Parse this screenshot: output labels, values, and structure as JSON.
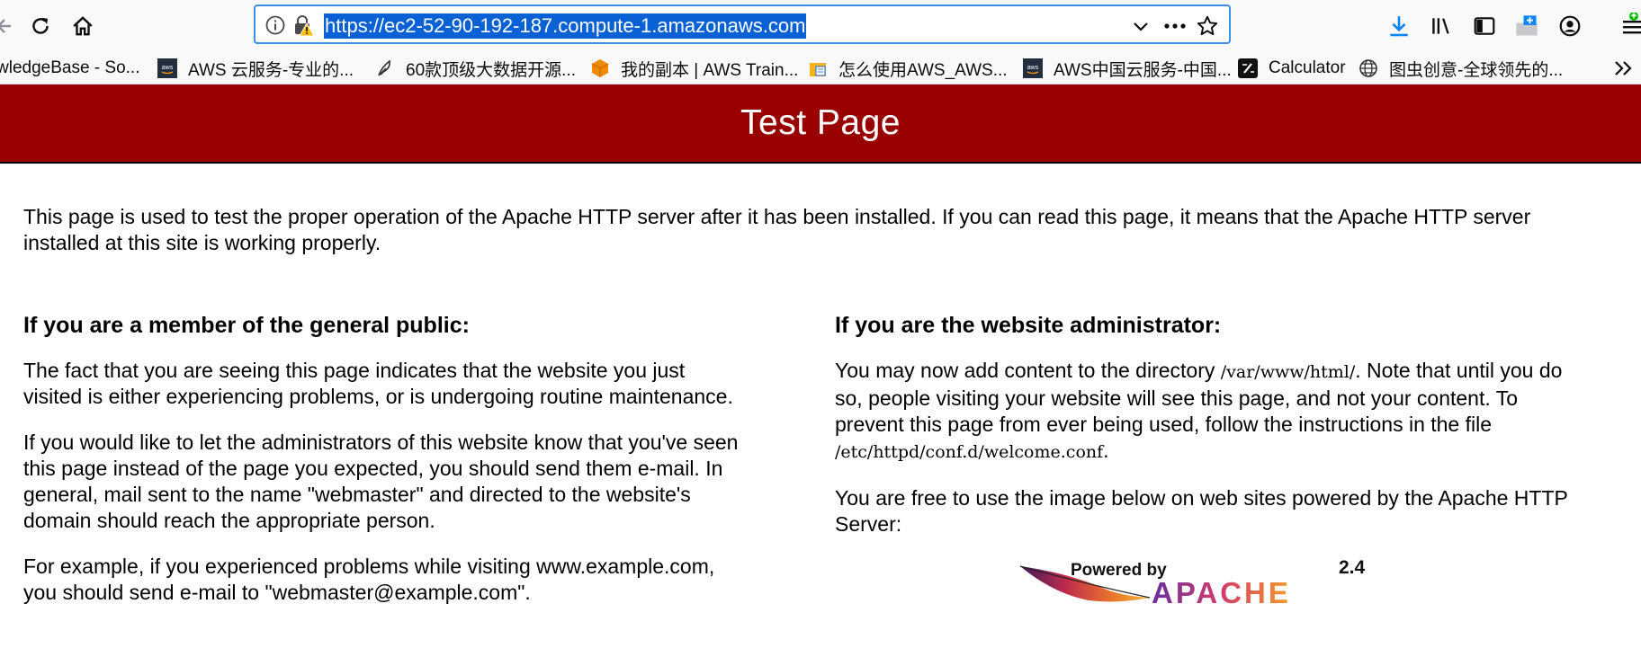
{
  "browser": {
    "url": "https://ec2-52-90-192-187.compute-1.amazonaws.com",
    "icons": [
      "back-icon",
      "reload-icon",
      "home-icon",
      "info-icon",
      "insecure-lock-icon",
      "dropdown-chevron-icon",
      "more-dots-icon",
      "bookmark-star-icon",
      "download-icon",
      "library-icon",
      "sidebar-icon",
      "screenshot-icon",
      "account-icon",
      "menu-icon"
    ],
    "accent_color": "#0a61d6"
  },
  "bookmarks": [
    {
      "label": "wledgeBase - So...",
      "icon": "none"
    },
    {
      "label": "AWS 云服务-专业的...",
      "icon": "aws-icon"
    },
    {
      "label": "60款顶级大数据开源...",
      "icon": "feather-icon"
    },
    {
      "label": "我的副本 | AWS Train...",
      "icon": "cube-icon"
    },
    {
      "label": "怎么使用AWS_AWS...",
      "icon": "box-icon"
    },
    {
      "label": "AWS中国云服务-中国...",
      "icon": "aws-icon"
    },
    {
      "label": "Calculator",
      "icon": "calculator-icon"
    },
    {
      "label": "图虫创意-全球领先的...",
      "icon": "globe-icon"
    }
  ],
  "page": {
    "title": "Test Page",
    "banner_color": "#990000",
    "intro": "This page is used to test the proper operation of the Apache HTTP server after it has been installed. If you can read this page, it means that the Apache HTTP server installed at this site is working properly.",
    "public": {
      "heading": "If you are a member of the general public:",
      "p1": "The fact that you are seeing this page indicates that the website you just visited is either experiencing problems, or is undergoing routine maintenance.",
      "p2": "If you would like to let the administrators of this website know that you've seen this page instead of the page you expected, you should send them e-mail. In general, mail sent to the name \"webmaster\" and directed to the website's domain should reach the appropriate person.",
      "p3": "For example, if you experienced problems while visiting www.example.com, you should send e-mail to \"webmaster@example.com\"."
    },
    "admin": {
      "heading": "If you are the website administrator:",
      "p1_a": "You may now add content to the directory ",
      "p1_path": "/var/www/html/",
      "p1_b": ". Note that until you do so, people visiting your website will see this page, and not your content. To prevent this page from ever being used, follow the instructions in the file ",
      "p1_file": "/etc/httpd/conf.d/welcome.conf",
      "p1_c": ".",
      "p2": "You are free to use the image below on web sites powered by the Apache HTTP Server:"
    },
    "logo": {
      "powered_by": "Powered by",
      "version": "2.4",
      "name": "APACHE"
    }
  }
}
